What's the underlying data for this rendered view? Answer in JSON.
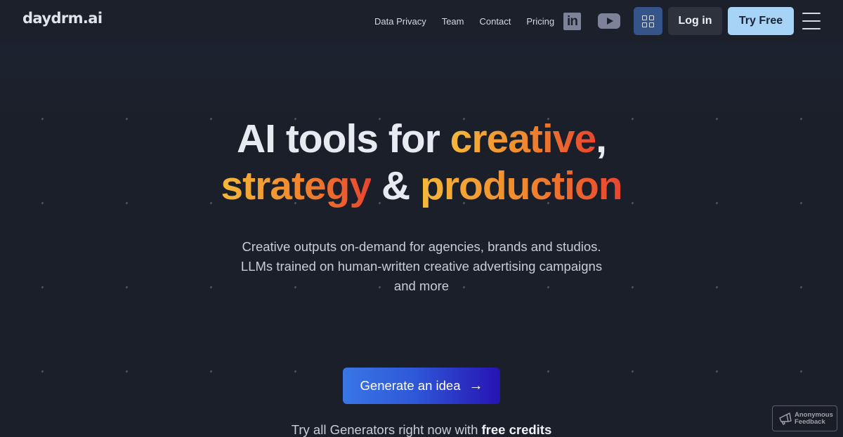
{
  "header": {
    "logo": "daydrm.ai",
    "nav": [
      "Data Privacy",
      "Team",
      "Contact",
      "Pricing"
    ],
    "social": [
      {
        "icon": "linkedin-icon",
        "label": "in"
      },
      {
        "icon": "youtube-icon"
      }
    ],
    "apps_icon": "grid-icon",
    "login_label": "Log in",
    "try_label": "Try Free",
    "menu_icon": "hamburger-icon"
  },
  "hero": {
    "headline": {
      "part1": "AI tools for ",
      "part2": "creative",
      "part3": ",",
      "part4": "strategy",
      "part5": " & ",
      "part6": "production"
    },
    "subtitle": "Creative outputs on-demand for agencies, brands and studios. LLMs trained on human-written creative advertising campaigns and more",
    "cta_label": "Generate an idea",
    "cta_arrow": "→",
    "free_note_prefix": "Try all Generators right now with ",
    "free_note_bold": "free credits"
  },
  "feedback": {
    "line1": "Anonymous",
    "line2": "Feedback"
  },
  "colors": {
    "background": "#1b1f2a",
    "accent_blue": "#a7d3f7",
    "apps_button": "#34548a",
    "gradient_start": "#f5b83a",
    "gradient_end": "#e8452f"
  }
}
